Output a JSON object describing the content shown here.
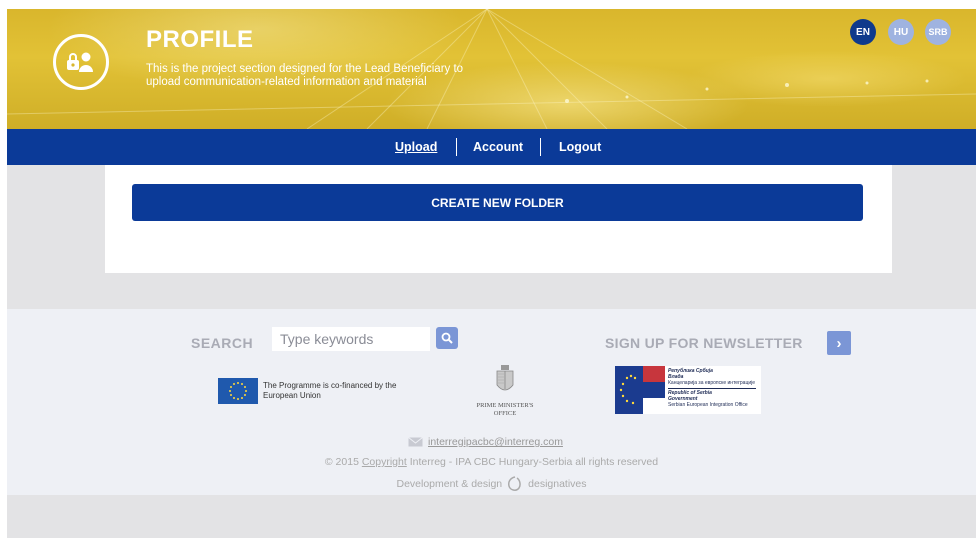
{
  "header": {
    "title": "PROFILE",
    "subtitle_line1": "This is the project section designed for the Lead Beneficiary to",
    "subtitle_line2": "upload communication-related information and material",
    "languages": [
      "EN",
      "HU",
      "SRB"
    ],
    "active_language": "EN"
  },
  "nav": {
    "items": [
      "Upload",
      "Account",
      "Logout"
    ],
    "active": "Upload"
  },
  "main": {
    "create_folder_label": "CREATE NEW FOLDER"
  },
  "footer": {
    "search_label": "SEARCH",
    "search_placeholder": "Type keywords",
    "newsletter_label": "SIGN UP FOR NEWSLETTER",
    "eu_text": "The Programme is co-financed by the European Union",
    "pmo_line1": "PRIME MINISTER'S",
    "pmo_line2": "OFFICE",
    "srb_lines": [
      "Република Србија",
      "Влада",
      "Канцеларија за европске интеграције",
      "Republic of Serbia",
      "Government",
      "Serbian European Integration Office"
    ],
    "email": "interregipacbc@interreg.com",
    "copyright_prefix": "© 2015",
    "copyright_link": "Copyright",
    "copyright_suffix": "Interreg - IPA CBC Hungary-Serbia all rights reserved",
    "credits_prefix": "Development & design",
    "credits_brand": "designatives"
  },
  "colors": {
    "brand_blue": "#0b3a98",
    "hero_gold": "#dfbd31",
    "accent_light_blue": "#7b96d6"
  }
}
